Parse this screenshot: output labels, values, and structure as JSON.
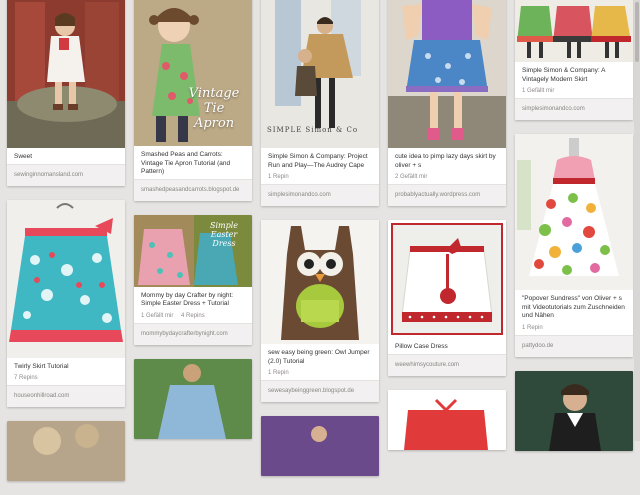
{
  "pins": {
    "c1p1": {
      "desc": "Sweet",
      "source": "sewinginnomansland.com"
    },
    "c1p2": {
      "desc": "Twirly Skirt Tutorial",
      "repins": "7 Repins",
      "source": "houseonhillroad.com"
    },
    "c2p1": {
      "desc": "Smashed Peas and Carrots: Vintage Tie Apron Tutorial (and Pattern)",
      "overlay": "Vintage Tie Apron",
      "source": "smashedpeasandcarrots.blogspot.de"
    },
    "c2p2": {
      "desc": "Mommy by day Crafter by night: Simple Easter Dress + Tutorial",
      "likes": "1 Gefällt mir",
      "repins": "4 Repins",
      "overlay": "Simple Easter Dress",
      "source": "mommybydaycrafterbynight.com"
    },
    "c3p1": {
      "desc": "Simple Simon & Company: Project Run and Play—The Audrey Cape",
      "repins": "1 Repin",
      "overlay": "SIMPLE Simon & Co",
      "source": "simplesimonandco.com"
    },
    "c3p2": {
      "desc": "sew easy being green: Owl Jumper (2.0) Tutorial",
      "repins": "1 Repin",
      "source": "sewesaybeinggreen.blogspot.de"
    },
    "c4p1": {
      "desc": "cute idea to pimp lazy days skirt by oliver + s",
      "likes": "2 Gefällt mir",
      "source": "probablyactually.wordpress.com"
    },
    "c4p2": {
      "desc": "Pillow Case Dress",
      "source": "weewhimsycouture.com"
    },
    "c5p1": {
      "desc": "Simple Simon & Company: A Vintagely Modern Skirt",
      "likes": "1 Gefällt mir",
      "source": "simplesimonandco.com"
    },
    "c5p2": {
      "desc": "\"Popover Sundress\" von Oliver + s mit Videotutorials zum Zuschneiden und Nähen",
      "repins": "1 Repin",
      "source": "pattydoo.de"
    }
  },
  "colors": {
    "background": "#e6e3e3",
    "card": "#ffffff",
    "source_bar": "#f2f0f0"
  }
}
